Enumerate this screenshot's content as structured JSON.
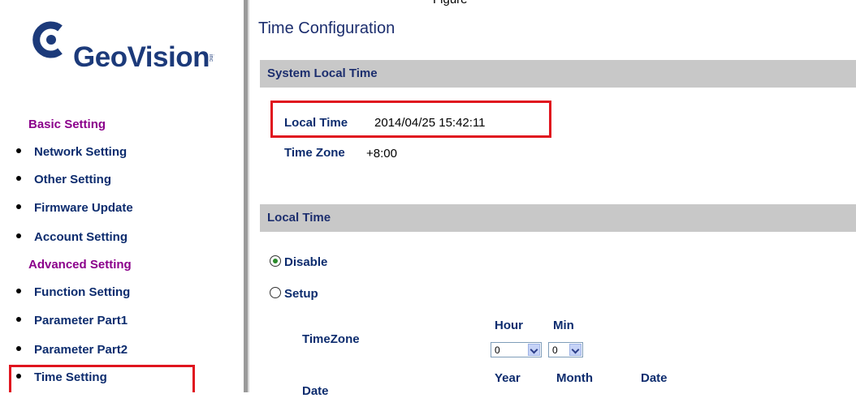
{
  "top_partial_text": "Figure",
  "logo": {
    "brand": "GeoVision",
    "inc": "inc"
  },
  "sidebar": {
    "basic_label": "Basic Setting",
    "basic_items": [
      {
        "label": "Network Setting"
      },
      {
        "label": "Other Setting"
      },
      {
        "label": "Firmware Update"
      },
      {
        "label": "Account Setting"
      }
    ],
    "advanced_label": "Advanced Setting",
    "advanced_items": [
      {
        "label": "Function Setting"
      },
      {
        "label": "Parameter Part1"
      },
      {
        "label": "Parameter Part2"
      },
      {
        "label": "Time Setting"
      }
    ]
  },
  "main": {
    "title": "Time Configuration",
    "system_local_time": {
      "header": "System Local Time",
      "local_time_label": "Local Time",
      "local_time_value": "2014/04/25 15:42:11",
      "time_zone_label": "Time Zone",
      "time_zone_value": "+8:00"
    },
    "local_time": {
      "header": "Local Time",
      "disable_label": "Disable",
      "setup_label": "Setup",
      "selected": "Disable",
      "timezone_label": "TimeZone",
      "hour_label": "Hour",
      "min_label": "Min",
      "hour_value": "0",
      "min_value": "0",
      "date_label": "Date",
      "year_label": "Year",
      "month_label": "Month",
      "date_col_label": "Date"
    }
  },
  "colors": {
    "highlight": "#e0141e",
    "bar": "#c8c8c8",
    "section": "#8b008b",
    "link": "#0d2c6e"
  }
}
